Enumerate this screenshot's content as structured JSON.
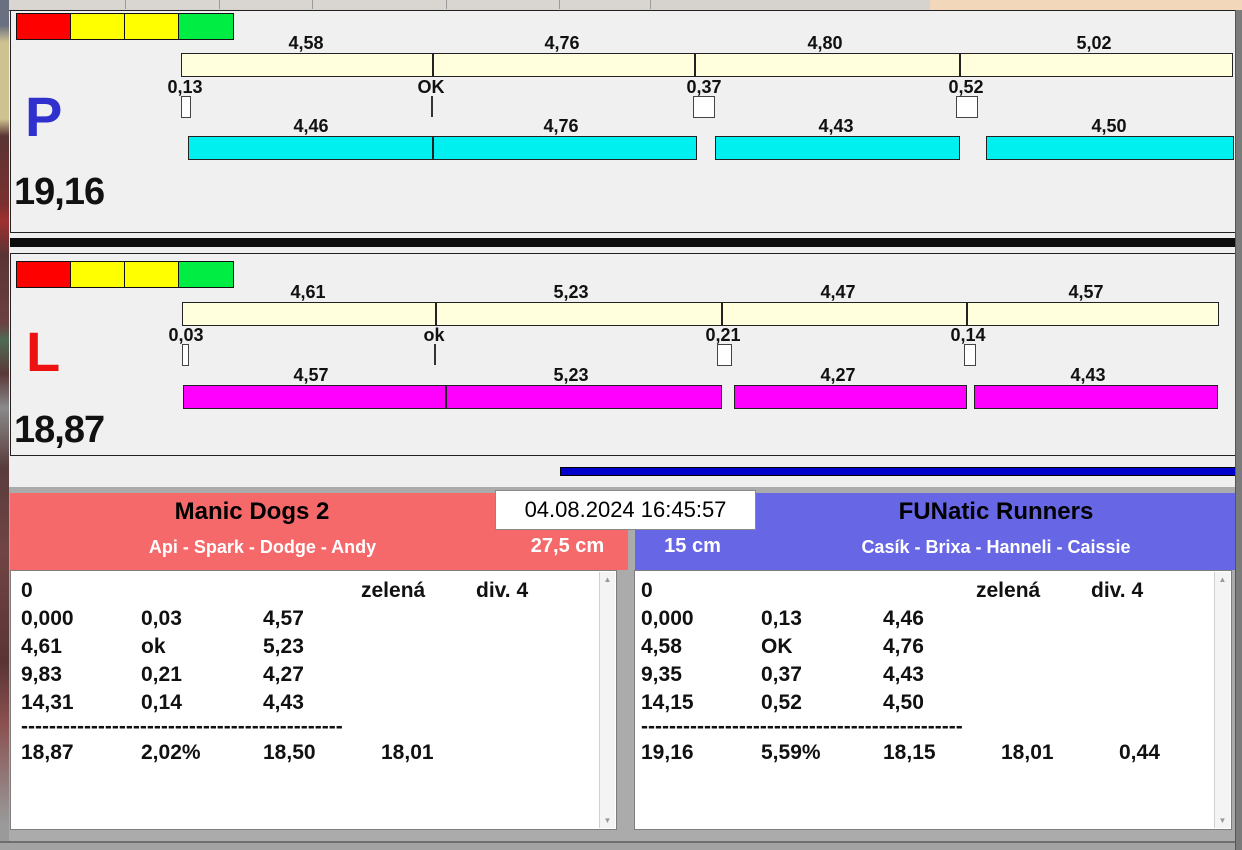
{
  "colors": {
    "cream_bar": "#FFFFDE",
    "cyan_bar": "#00F0F0",
    "magenta_bar": "#FF00FF",
    "left_header": "#F5696B",
    "right_header": "#6767E6",
    "progress_blue": "#0000CC",
    "light_red": "#FF0000",
    "light_yellow": "#FFFF00",
    "light_green": "#00EE44",
    "lane_p_letter": "#3030CF",
    "lane_l_letter": "#EE1111"
  },
  "timestamp": "04.08.2024 16:45:57",
  "lane_p": {
    "label": "P",
    "total": "19,16",
    "upper_splits": [
      "4,58",
      "4,76",
      "4,80",
      "5,02"
    ],
    "markers": [
      "0,13",
      "OK",
      "0,37",
      "0,52"
    ],
    "lower_splits": [
      "4,46",
      "4,76",
      "4,43",
      "4,50"
    ]
  },
  "lane_l": {
    "label": "L",
    "total": "18,87",
    "upper_splits": [
      "4,61",
      "5,23",
      "4,47",
      "4,57"
    ],
    "markers": [
      "0,03",
      "ok",
      "0,21",
      "0,14"
    ],
    "lower_splits": [
      "4,57",
      "5,23",
      "4,27",
      "4,43"
    ]
  },
  "left_team": {
    "name": "Manic Dogs 2",
    "members": "Api - Spark - Dodge - Andy",
    "jump_height": "27,5 cm",
    "info": {
      "start": "0",
      "category": "zelená",
      "division": "div. 4"
    },
    "runs": [
      [
        "0,000",
        "0,03",
        "4,57"
      ],
      [
        "4,61",
        "ok",
        "5,23"
      ],
      [
        "9,83",
        "0,21",
        "4,27"
      ],
      [
        "14,31",
        "0,14",
        "4,43"
      ]
    ],
    "separator": "----------------------------------------------",
    "totals": [
      "18,87",
      "2,02%",
      "18,50",
      "18,01"
    ]
  },
  "right_team": {
    "name": "FUNatic Runners",
    "members": "Casík - Brixa - Hanneli - Caissie",
    "jump_height": "15 cm",
    "info": {
      "start": "0",
      "category": "zelená",
      "division": "div. 4"
    },
    "runs": [
      [
        "0,000",
        "0,13",
        "4,46"
      ],
      [
        "4,58",
        "OK",
        "4,76"
      ],
      [
        "9,35",
        "0,37",
        "4,43"
      ],
      [
        "14,15",
        "0,52",
        "4,50"
      ]
    ],
    "separator": "----------------------------------------------",
    "totals": [
      "19,16",
      "5,59%",
      "18,15",
      "18,01",
      "0,44"
    ]
  }
}
